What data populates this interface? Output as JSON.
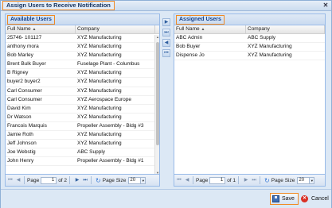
{
  "window": {
    "title": "Assign Users to Receive Notification",
    "close_glyph": "✕"
  },
  "available": {
    "title": "Available Users",
    "columns": {
      "name": "Full Name",
      "company": "Company"
    },
    "rows": [
      {
        "name": "25746- 101127",
        "company": "XYZ Manufacturing"
      },
      {
        "name": "anthony mora",
        "company": "XYZ Manufacturing"
      },
      {
        "name": "Bob Marley",
        "company": "XYZ Manufacturing"
      },
      {
        "name": "Brent Bulk Buyer",
        "company": "Fuselage Plant - Columbus"
      },
      {
        "name": "B Rigney",
        "company": "XYZ Manufacturing"
      },
      {
        "name": "buyer2 buyer2",
        "company": "XYZ Manufacturing"
      },
      {
        "name": "Carl Consumer",
        "company": "XYZ Manufacturing"
      },
      {
        "name": "Carl Consumer",
        "company": "XYZ Aerospace Europe"
      },
      {
        "name": "David Kim",
        "company": "XYZ Manufacturing"
      },
      {
        "name": "Dr Watson",
        "company": "XYZ Manufacturing"
      },
      {
        "name": "Francois Marquis",
        "company": "Propeller Assembly - Bldg #3"
      },
      {
        "name": "Jamie Roth",
        "company": "XYZ Manufacturing"
      },
      {
        "name": "Jeff Johnson",
        "company": "XYZ Manufacturing"
      },
      {
        "name": "Joe Webstig",
        "company": "ABC Supply"
      },
      {
        "name": "John Henry",
        "company": "Propeller Assembly - Bldg #1"
      }
    ],
    "pager": {
      "page_label": "Page",
      "page_value": "1",
      "of_label": "of 2",
      "size_label": "Page Size",
      "size_value": "20"
    }
  },
  "assigned": {
    "title": "Assigned Users",
    "columns": {
      "name": "Full Name",
      "company": "Company"
    },
    "rows": [
      {
        "name": "ABC Admin",
        "company": "ABC Supply"
      },
      {
        "name": "Bob Buyer",
        "company": "XYZ Manufacturing"
      },
      {
        "name": "Dispense Jo",
        "company": "XYZ Manufacturing"
      }
    ],
    "pager": {
      "page_label": "Page",
      "page_value": "1",
      "of_label": "of 1",
      "size_label": "Page Size",
      "size_value": "20"
    }
  },
  "transfer_buttons": [
    "▶",
    "⏭",
    "◀",
    "⏮"
  ],
  "footer": {
    "save_label": "Save",
    "cancel_label": "Cancel"
  },
  "colors": {
    "highlight": "#f08a24",
    "panel_border": "#99bbe8"
  }
}
